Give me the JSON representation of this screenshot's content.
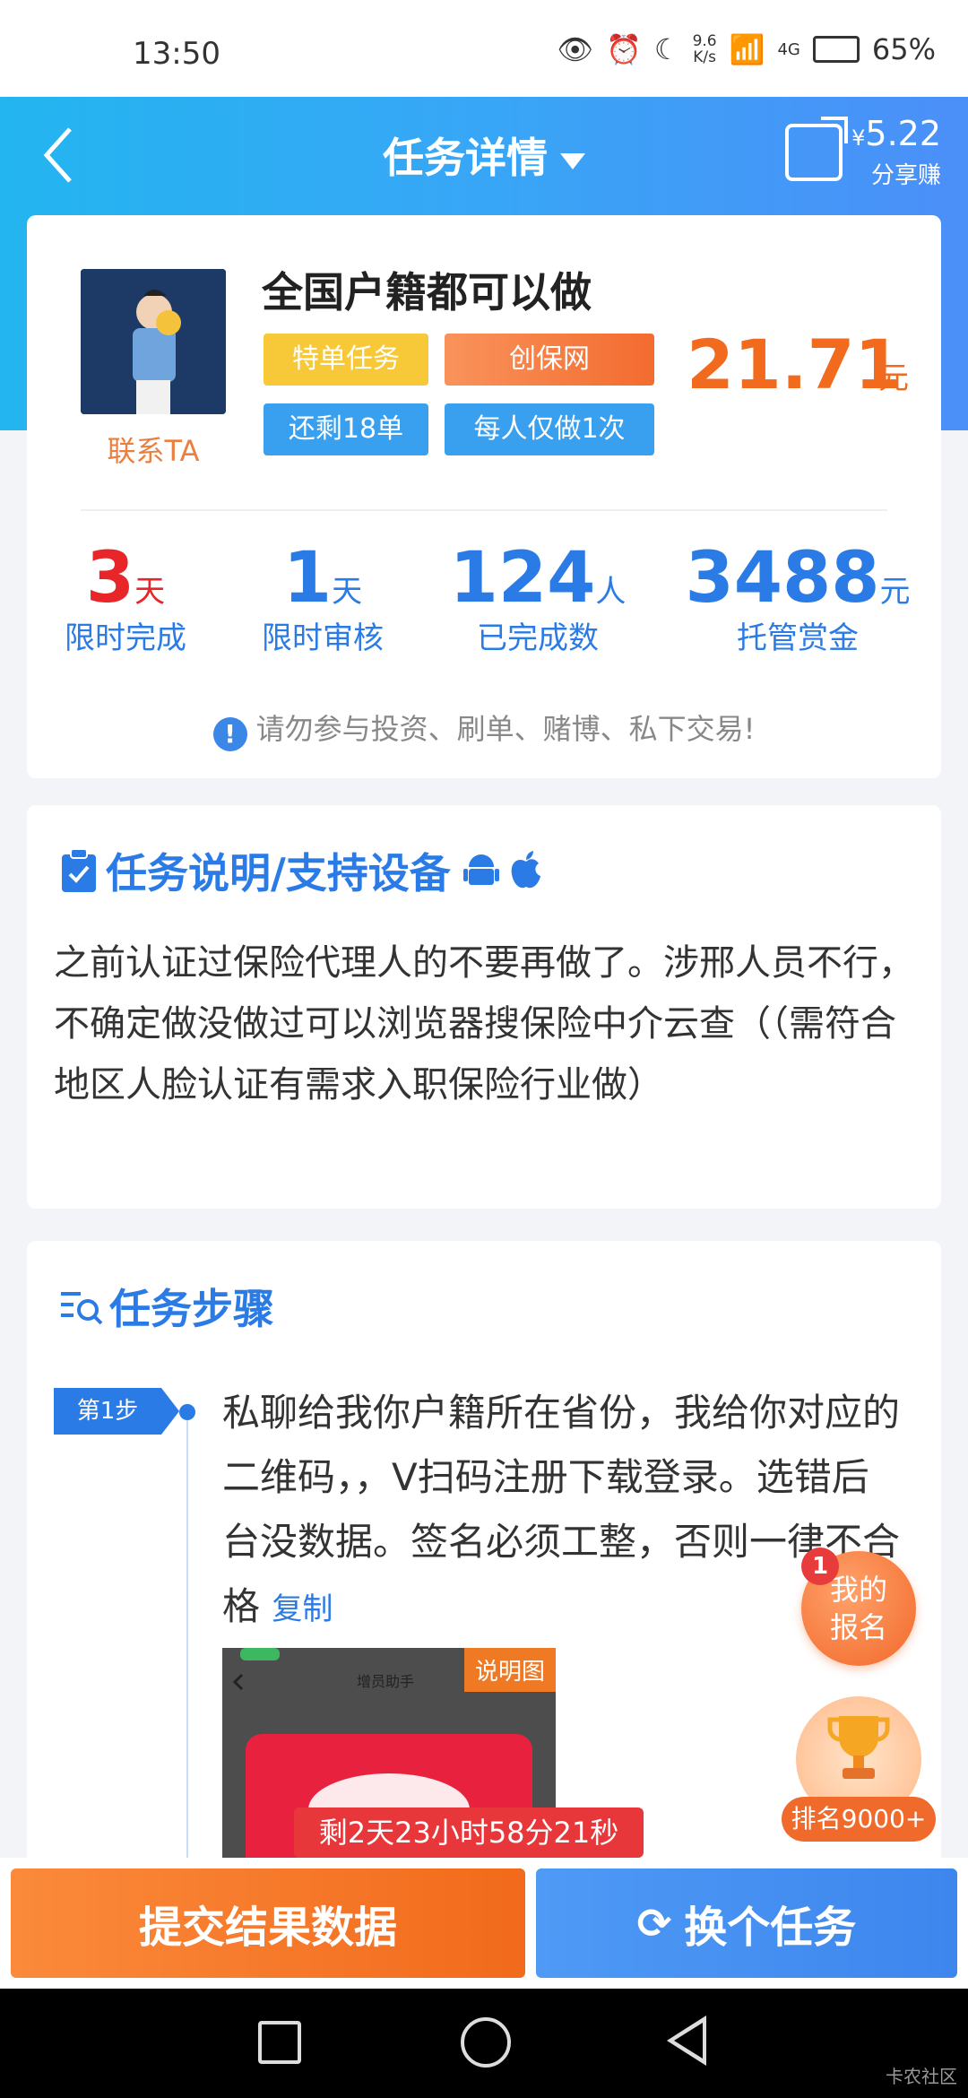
{
  "status_bar": {
    "time": "13:50",
    "speed_top": "9.6",
    "speed_bottom": "K/s",
    "network": "4G",
    "battery": "65%"
  },
  "header": {
    "title": "任务详情",
    "share_currency": "¥",
    "share_amount": "5.22",
    "share_label": "分享赚"
  },
  "task": {
    "name": "全国户籍都可以做",
    "contact_label": "联系TA",
    "tags": [
      "特单任务",
      "创保网",
      "还剩18单",
      "每人仅做1次"
    ],
    "price": "21.71",
    "price_unit": "元",
    "stats": [
      {
        "num": "3",
        "unit": "天",
        "label": "限时完成"
      },
      {
        "num": "1",
        "unit": "天",
        "label": "限时审核"
      },
      {
        "num": "124",
        "unit": "人",
        "label": "已完成数"
      },
      {
        "num": "3488",
        "unit": "元",
        "label": "托管赏金"
      }
    ],
    "warning": "请勿参与投资、刷单、赌博、私下交易!"
  },
  "description": {
    "title": "任务说明/支持设备",
    "text": "之前认证过保险代理人的不要再做了。涉邢人员不行，不确定做没做过可以浏览器搜保险中介云查（（需符合地区人脸认证有需求入职保险行业做）"
  },
  "steps": {
    "title": "任务步骤",
    "step1_badge": "第1步",
    "step1_text": "私聊给我你户籍所在省份，我给你对应的二维码，，V扫码注册下载登录。选错后台没数据。签名必须工整，否则一律不合格",
    "copy_label": "复制",
    "image_label": "说明图",
    "image_caption": "增员助手"
  },
  "floating": {
    "signup_badge": "1",
    "signup_label": "我的报名",
    "rank_label": "排名9000+",
    "countdown": "剩2天23小时58分21秒"
  },
  "buttons": {
    "submit": "提交结果数据",
    "switch": "换个任务"
  },
  "watermark": "卡农社区",
  "colors": {
    "primary_blue": "#2b7be6",
    "accent_orange": "#f16a1e",
    "stat_red": "#e8262a"
  }
}
